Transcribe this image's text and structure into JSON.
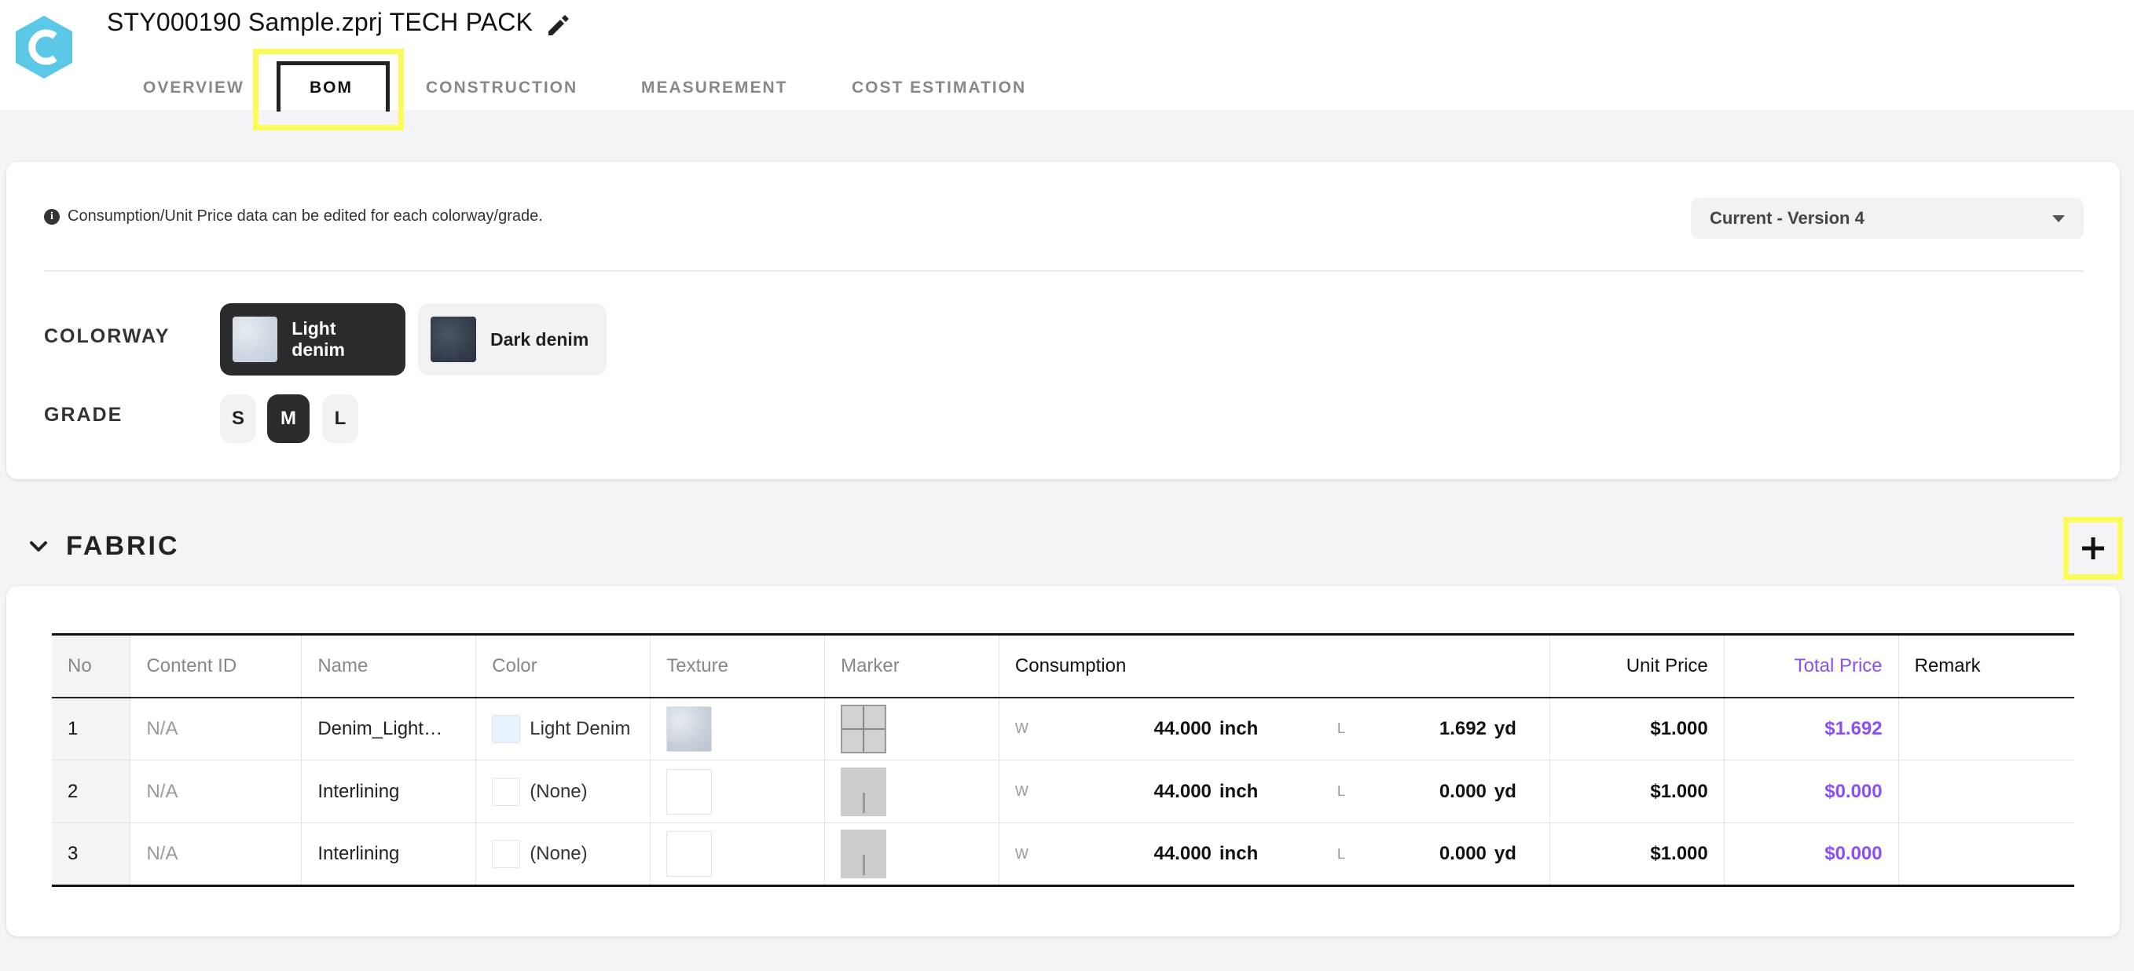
{
  "header": {
    "title": "STY000190 Sample.zprj TECH PACK",
    "tabs": [
      {
        "label": "OVERVIEW"
      },
      {
        "label": "BOM"
      },
      {
        "label": "CONSTRUCTION"
      },
      {
        "label": "MEASUREMENT"
      },
      {
        "label": "COST ESTIMATION"
      }
    ],
    "active_tab": "BOM",
    "highlight_color": "#fafa58",
    "brand_color": "#5bc8e8"
  },
  "settings": {
    "info_text": "Consumption/Unit Price data can be edited for each colorway/grade.",
    "version": "Current - Version 4",
    "colorway_label": "COLORWAY",
    "colorways": [
      {
        "name": "Light denim",
        "selected": true
      },
      {
        "name": "Dark denim",
        "selected": false
      }
    ],
    "grade_label": "GRADE",
    "grades": [
      {
        "name": "S",
        "selected": false
      },
      {
        "name": "M",
        "selected": true
      },
      {
        "name": "L",
        "selected": false
      }
    ]
  },
  "fabric": {
    "title": "FABRIC",
    "columns": {
      "no": "No",
      "content_id": "Content ID",
      "name": "Name",
      "color": "Color",
      "texture": "Texture",
      "marker": "Marker",
      "consumption": "Consumption",
      "unit_price": "Unit Price",
      "total_price": "Total Price",
      "remark": "Remark"
    },
    "rows": [
      {
        "no": "1",
        "content_id": "N/A",
        "name": "Denim_Light…",
        "color": "Light Denim",
        "w_label": "W",
        "w_value": "44.000",
        "w_unit": "inch",
        "l_label": "L",
        "l_value": "1.692",
        "l_unit": "yd",
        "unit_price": "$1.000",
        "total_price": "$1.692",
        "remark": ""
      },
      {
        "no": "2",
        "content_id": "N/A",
        "name": "Interlining",
        "color": "(None)",
        "w_label": "W",
        "w_value": "44.000",
        "w_unit": "inch",
        "l_label": "L",
        "l_value": "0.000",
        "l_unit": "yd",
        "unit_price": "$1.000",
        "total_price": "$0.000",
        "remark": ""
      },
      {
        "no": "3",
        "content_id": "N/A",
        "name": "Interlining",
        "color": "(None)",
        "w_label": "W",
        "w_value": "44.000",
        "w_unit": "inch",
        "l_label": "L",
        "l_value": "0.000",
        "l_unit": "yd",
        "unit_price": "$1.000",
        "total_price": "$0.000",
        "remark": ""
      }
    ],
    "total_price_color": "#8a4ff5"
  }
}
